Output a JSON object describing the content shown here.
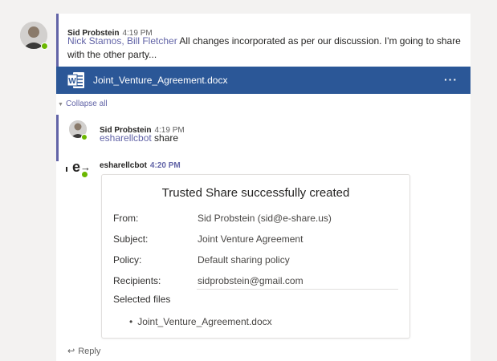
{
  "message1": {
    "author": "Sid Probstein",
    "time": "4:19 PM",
    "mentions": "Nick Stamos, Bill Fletcher",
    "text_line1": " All changes incorporated as per our discussion. I'm going to share",
    "text_line2": "with the other party..."
  },
  "attachment": {
    "file_name": "Joint_Venture_Agreement.docx",
    "icon": "word-icon",
    "more": "···",
    "brand_color": "#2b5797"
  },
  "collapse_label": "Collapse all",
  "message2": {
    "author": "Sid Probstein",
    "time": "4:19 PM",
    "mention": "esharellcbot",
    "text": " share"
  },
  "bot_message": {
    "author": "esharellcbot",
    "time": "4:20 PM",
    "card": {
      "title": "Trusted Share successfully created",
      "rows": [
        {
          "label": "From:",
          "value": "Sid Probstein (sid@e-share.us)"
        },
        {
          "label": "Subject:",
          "value": "Joint Venture Agreement"
        },
        {
          "label": "Policy:",
          "value": "Default sharing policy"
        },
        {
          "label": "Recipients:",
          "value": "sidprobstein@gmail.com"
        }
      ],
      "selected_files_label": "Selected files",
      "files": [
        "Joint_Venture_Agreement.docx"
      ]
    }
  },
  "reply_label": "Reply",
  "colors": {
    "accent": "#6264a7",
    "presence": "#6bb700"
  }
}
